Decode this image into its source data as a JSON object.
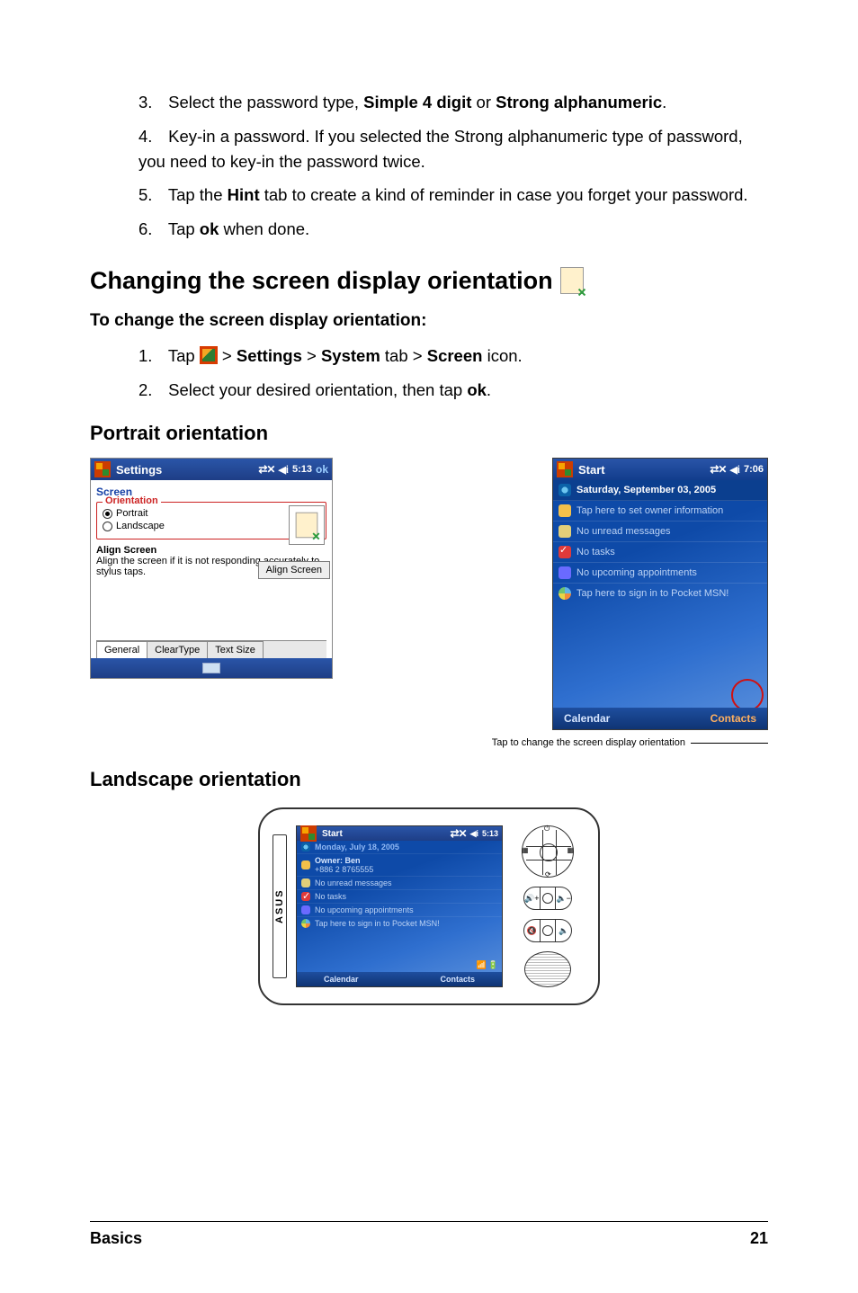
{
  "steps": {
    "s3_num": "3.",
    "s3_a": "Select the password type, ",
    "s3_b": "Simple 4 digit",
    "s3_c": " or ",
    "s3_d": "Strong alphanumeric",
    "s3_e": ".",
    "s4_num": "4.",
    "s4": "Key-in a password. If you selected the Strong alphanumeric type of password, you need to key-in the password twice.",
    "s5_num": "5.",
    "s5_a": "Tap the ",
    "s5_b": "Hint",
    "s5_c": " tab to create a kind of reminder in case you forget your password.",
    "s6_num": "6.",
    "s6_a": "Tap ",
    "s6_b": "ok",
    "s6_c": " when done."
  },
  "heading": "Changing the screen display orientation",
  "subheading": "To change the screen display orientation:",
  "nav": {
    "n1_num": "1.",
    "n1_a": "Tap ",
    "n1_b": " > ",
    "n1_c": "Settings",
    "n1_d": " > ",
    "n1_e": "System",
    "n1_f": " tab > ",
    "n1_g": "Screen",
    "n1_h": " icon.",
    "n2_num": "2.",
    "n2_a": "Select your desired orientation, then tap ",
    "n2_b": "ok",
    "n2_c": "."
  },
  "orient_portrait": "Portrait orientation",
  "orient_landscape": "Landscape orientation",
  "settings_shot": {
    "title": "Settings",
    "time": "5:13",
    "ok": "ok",
    "screen": "Screen",
    "orientation": "Orientation",
    "portrait": "Portrait",
    "landscape": "Landscape",
    "align_title": "Align Screen",
    "align_desc": "Align the screen if it is not responding accurately to stylus taps.",
    "align_btn": "Align Screen",
    "tab_general": "General",
    "tab_clear": "ClearType",
    "tab_text": "Text Size"
  },
  "today_shot": {
    "title": "Start",
    "time": "7:06",
    "date": "Saturday, September 03, 2005",
    "owner": "Tap here to set owner information",
    "msgs": "No unread messages",
    "tasks": "No tasks",
    "appts": "No upcoming appointments",
    "msn": "Tap here to sign in to Pocket MSN!",
    "calendar": "Calendar",
    "contacts": "Contacts"
  },
  "callout": "Tap to change the screen display orientation",
  "landscape_shot": {
    "brand": "ASUS",
    "title": "Start",
    "time": "5:13",
    "date": "Monday, July 18, 2005",
    "owner": "Owner: Ben",
    "phone": "+886 2 8765555",
    "msgs": "No unread messages",
    "tasks": "No tasks",
    "appts": "No upcoming appointments",
    "msn": "Tap here to sign in to Pocket MSN!",
    "calendar": "Calendar",
    "contacts": "Contacts",
    "vol_up": "🔊+",
    "vol_dn": "🔈−"
  },
  "footer": {
    "left": "Basics",
    "right": "21"
  }
}
